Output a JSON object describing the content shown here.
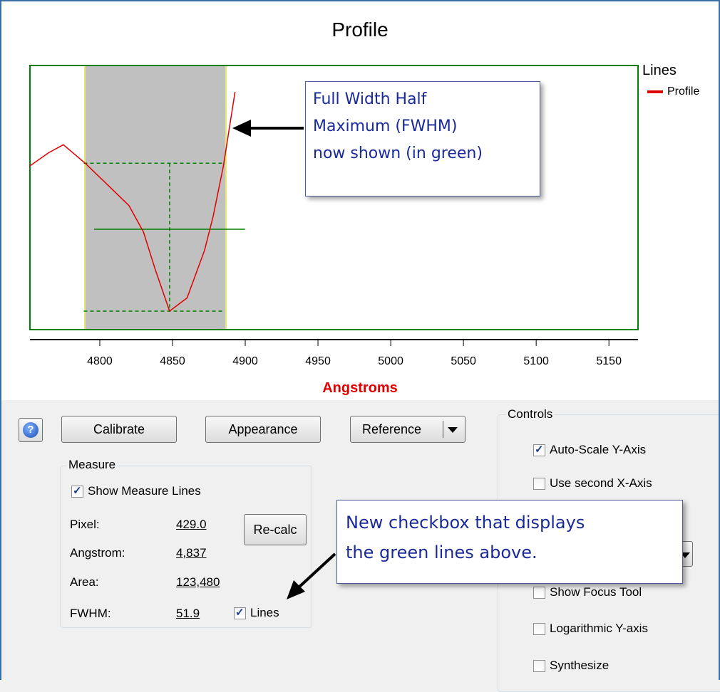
{
  "chart": {
    "title": "Profile",
    "legend_title": "Lines",
    "legend_entry": "Profile",
    "x_axis_label": "Angstroms",
    "x_ticks": [
      "4800",
      "4850",
      "4900",
      "4950",
      "5000",
      "5050",
      "5100",
      "5150"
    ],
    "colors": {
      "profile": "#e00000",
      "fwhm": "#008000",
      "selection": "#c0c0c0",
      "frame": "#008000"
    }
  },
  "chart_data": {
    "type": "line",
    "title": "Profile",
    "xlabel": "Angstroms",
    "ylabel": "",
    "xlim": [
      4752,
      5170
    ],
    "series": [
      {
        "name": "Profile",
        "x": [
          4752,
          4765,
          4775,
          4790,
          4805,
          4820,
          4830,
          4838,
          4848,
          4860,
          4872,
          4878,
          4885,
          4893
        ],
        "y": [
          0.62,
          0.67,
          0.7,
          0.63,
          0.55,
          0.47,
          0.37,
          0.23,
          0.07,
          0.12,
          0.3,
          0.43,
          0.62,
          0.9
        ]
      }
    ],
    "selection_range": [
      4789,
      4885
    ],
    "fwhm": {
      "center": 4848,
      "half_width": 51.9
    }
  },
  "callouts": {
    "fwhm": [
      "Full Width Half",
      "Maximum (FWHM)",
      "now shown (in green)"
    ],
    "checkbox": [
      "New checkbox that displays",
      "the green lines above."
    ]
  },
  "toolbar": {
    "calibrate_label": "Calibrate",
    "appearance_label": "Appearance",
    "reference_label": "Reference"
  },
  "measure": {
    "group_label": "Measure",
    "show_lines_label": "Show Measure Lines",
    "pixel_label": "Pixel:",
    "pixel_value": "429.0",
    "angstrom_label": "Angstrom:",
    "angstrom_value": "4,837",
    "area_label": "Area:",
    "area_value": "123,480",
    "fwhm_label": "FWHM:",
    "fwhm_value": "51.9",
    "lines_label": "Lines",
    "recalc_label": "Re-calc"
  },
  "controls": {
    "group_label": "Controls",
    "auto_scale_label": "Auto-Scale Y-Axis",
    "second_x_label": "Use second X-Axis",
    "focus_tool_label": "Show Focus Tool",
    "log_y_label": "Logarithmic Y-axis",
    "synthesize_label": "Synthesize"
  }
}
